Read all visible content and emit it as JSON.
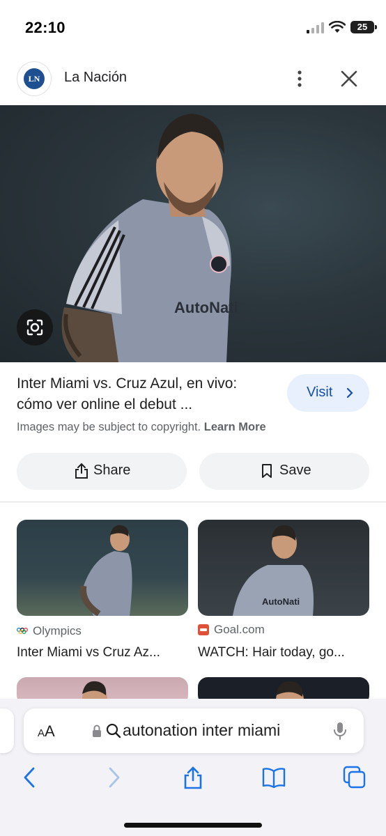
{
  "status_bar": {
    "time": "22:10",
    "battery": "25"
  },
  "source": {
    "logo_text": "LN",
    "name": "La Nación"
  },
  "result": {
    "title": "Inter Miami vs. Cruz Azul, en vivo: cómo ver online el debut ...",
    "visit_label": "Visit",
    "copyright_text": "Images may be subject to copyright.",
    "learn_more": "Learn More",
    "share_label": "Share",
    "save_label": "Save"
  },
  "related": [
    {
      "source": "Olympics",
      "title": "Inter Miami vs Cruz Az..."
    },
    {
      "source": "Goal.com",
      "title": "WATCH: Hair today, go..."
    }
  ],
  "url_bar": {
    "aa_label": "AA",
    "query": "autonation inter miami"
  },
  "colors": {
    "accent": "#174ea6",
    "visit_bg": "#e8f0fe",
    "pill_bg": "#f1f3f4"
  }
}
